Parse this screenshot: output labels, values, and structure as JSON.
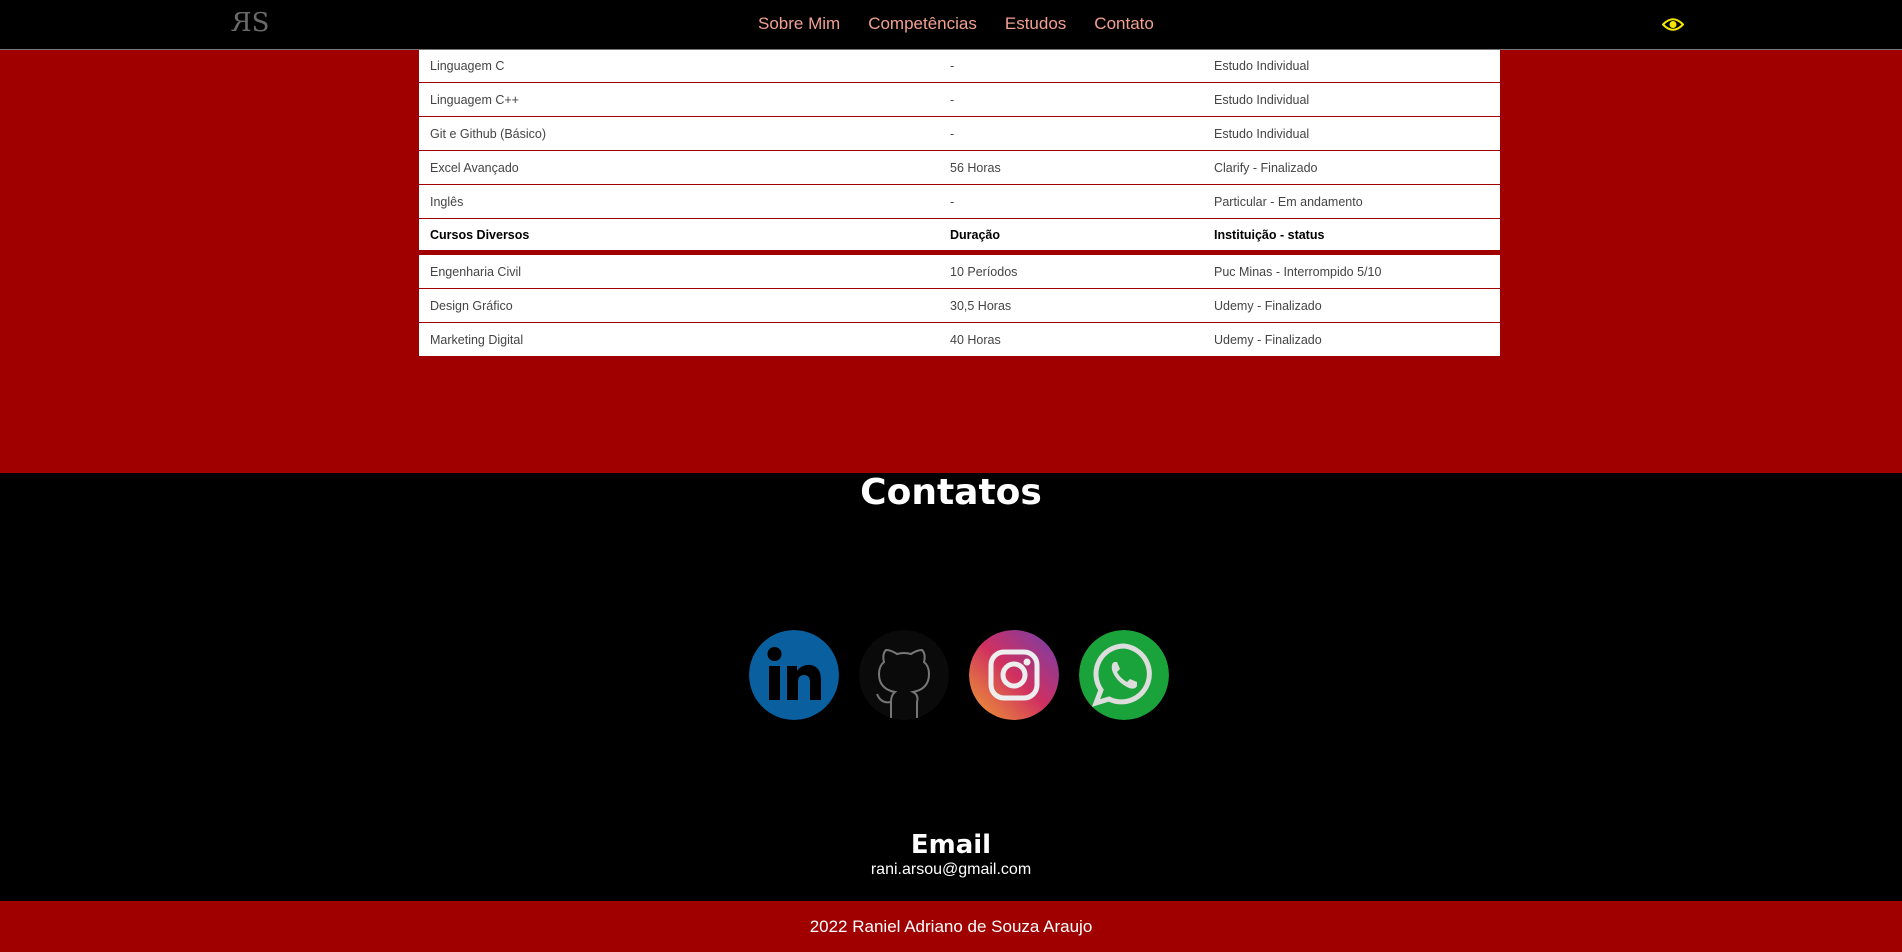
{
  "header": {
    "logo_text": "SR",
    "nav": [
      "Sobre Mim",
      "Competências",
      "Estudos",
      "Contato"
    ],
    "accessibility_icon": "eye-icon",
    "colors": {
      "nav_link": "#f2a090",
      "eye": "#f5e600"
    }
  },
  "studies": {
    "rows_top": [
      [
        "Linguagem C",
        "-",
        "Estudo Individual"
      ],
      [
        "Linguagem C++",
        "-",
        "Estudo Individual"
      ],
      [
        "Git e Github (Básico)",
        "-",
        "Estudo Individual"
      ],
      [
        "Excel Avançado",
        "56 Horas",
        "Clarify - Finalizado"
      ],
      [
        "Inglês",
        "-",
        "Particular - Em andamento"
      ]
    ],
    "header_row": [
      "Cursos Diversos",
      "Duração",
      "Instituição - status"
    ],
    "rows_bottom": [
      [
        "Engenharia Civil",
        "10 Períodos",
        "Puc Minas - Interrompido 5/10"
      ],
      [
        "Design Gráfico",
        "30,5 Horas",
        "Udemy - Finalizado"
      ],
      [
        "Marketing Digital",
        "40 Horas",
        "Udemy - Finalizado"
      ]
    ],
    "colors": {
      "background": "#a00000"
    }
  },
  "contacts": {
    "title": "Contatos",
    "socials": [
      "linkedin-icon",
      "github-icon",
      "instagram-icon",
      "whatsapp-icon"
    ],
    "email_title": "Email",
    "email": "rani.arsou@gmail.com"
  },
  "footer": {
    "text": "2022 Raniel Adriano de Souza Araujo"
  }
}
